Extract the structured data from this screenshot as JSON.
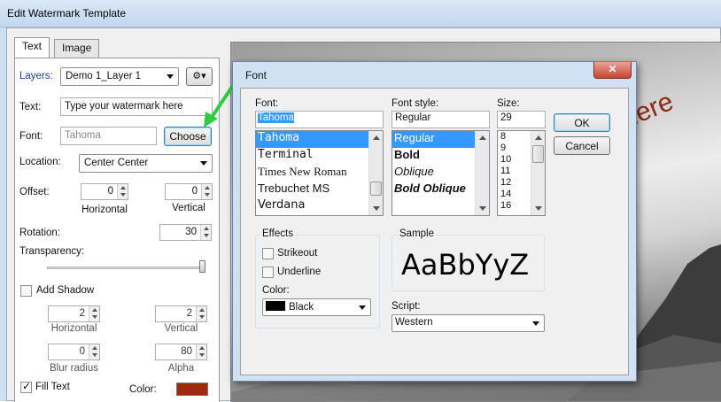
{
  "window": {
    "title": "Edit Watermark Template"
  },
  "tabs": [
    {
      "label": "Text"
    },
    {
      "label": "Image"
    }
  ],
  "text_panel": {
    "layers_label": "Layers:",
    "layers_value": "Demo 1_Layer 1",
    "gear_menu_arrow": "▾",
    "text_label": "Text:",
    "text_value": "Type your watermark here",
    "font_label": "Font:",
    "font_value": "Tahoma",
    "choose_button": "Choose",
    "location_label": "Location:",
    "location_value": "Center Center",
    "offset_label": "Offset:",
    "offset_h": "0",
    "offset_v": "0",
    "horizontal_label": "Horizontal",
    "vertical_label": "Vertical",
    "rotation_label": "Rotation:",
    "rotation_value": "30",
    "transparency_label": "Transparency:",
    "transparency_level": 1.0,
    "add_shadow_label": "Add Shadow",
    "add_shadow_checked": false,
    "shadow_h": "2",
    "shadow_v": "2",
    "shadow_horizontal_label": "Horizontal",
    "shadow_vertical_label": "Vertical",
    "blur_value": "0",
    "blur_label": "Blur radius",
    "alpha_value": "80",
    "alpha_label": "Alpha",
    "fill_text_label": "Fill Text",
    "fill_text_checked": true,
    "color_label": "Color:",
    "fill_color": "#9b2c0b"
  },
  "preview": {
    "watermark_text": "here",
    "watermark_color": "#8b2a12"
  },
  "font_dialog": {
    "title": "Font",
    "close_glyph": "✕",
    "font_label": "Font:",
    "font_value": "Tahoma",
    "fonts": [
      "Tahoma",
      "Terminal",
      "Times New Roman",
      "Trebuchet MS",
      "Verdana"
    ],
    "selected_font": "Tahoma",
    "style_label": "Font style:",
    "style_value": "Regular",
    "styles": [
      "Regular",
      "Bold",
      "Oblique",
      "Bold Oblique"
    ],
    "size_label": "Size:",
    "size_value": "29",
    "sizes": [
      "8",
      "9",
      "10",
      "11",
      "12",
      "14",
      "16"
    ],
    "ok_button": "OK",
    "cancel_button": "Cancel",
    "effects_label": "Effects",
    "strikeout_label": "Strikeout",
    "underline_label": "Underline",
    "color_label": "Color:",
    "color_value": "Black",
    "color_swatch": "#000000",
    "sample_label": "Sample",
    "sample_text": "AaBbYyZ",
    "script_label": "Script:",
    "script_value": "Western"
  }
}
